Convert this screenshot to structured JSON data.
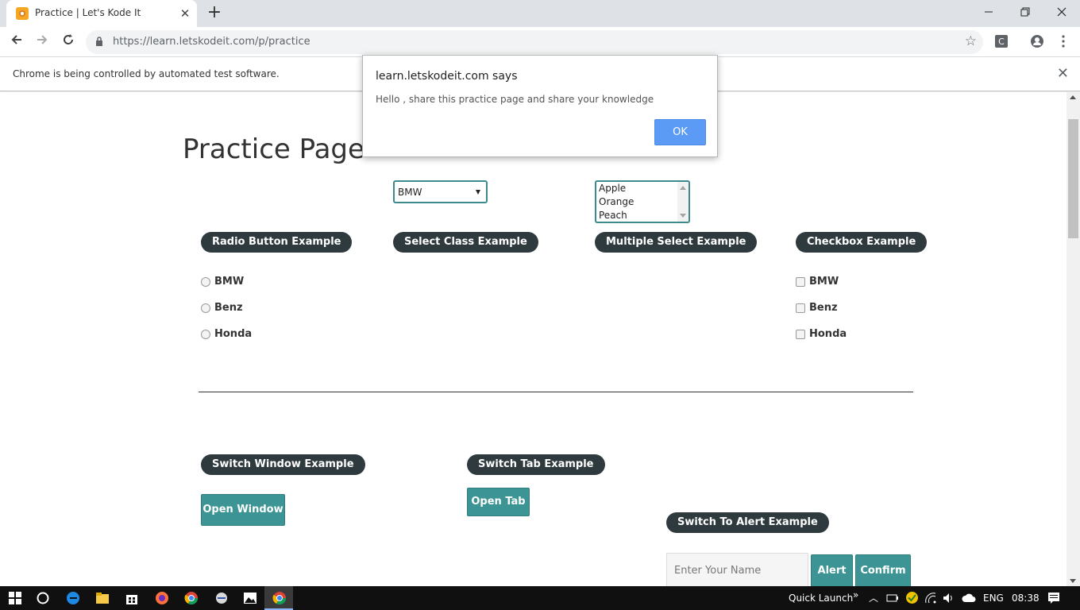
{
  "browser": {
    "tab_title": "Practice | Let's Kode It",
    "url": "https://learn.letskodeit.com/p/practice",
    "infobar_message": "Chrome is being controlled by automated test software.",
    "extension_label": "C"
  },
  "page": {
    "heading": "Practice Page",
    "radio_section": {
      "title": "Radio Button Example",
      "options": [
        "BMW",
        "Benz",
        "Honda"
      ]
    },
    "select_section": {
      "title": "Select Class Example",
      "selected": "BMW"
    },
    "multi_section": {
      "title": "Multiple Select Example",
      "options": [
        "Apple",
        "Orange",
        "Peach"
      ]
    },
    "checkbox_section": {
      "title": "Checkbox Example",
      "options": [
        "BMW",
        "Benz",
        "Honda"
      ]
    },
    "switch_window": {
      "title": "Switch Window Example",
      "button": "Open Window"
    },
    "switch_tab": {
      "title": "Switch Tab Example",
      "button": "Open Tab"
    },
    "switch_alert": {
      "title": "Switch To Alert Example",
      "placeholder": "Enter Your Name",
      "alert_button": "Alert",
      "confirm_button": "Confirm"
    }
  },
  "dialog": {
    "title": "learn.letskodeit.com says",
    "message": "Hello , share this practice page and share your knowledge",
    "ok_label": "OK"
  },
  "taskbar": {
    "quick_launch": "Quick Launch",
    "language": "ENG",
    "time": "08:38"
  },
  "colors": {
    "pill_bg": "#2f3a3f",
    "button_teal": "#3c9494",
    "ok_blue": "#5b9bf5"
  }
}
